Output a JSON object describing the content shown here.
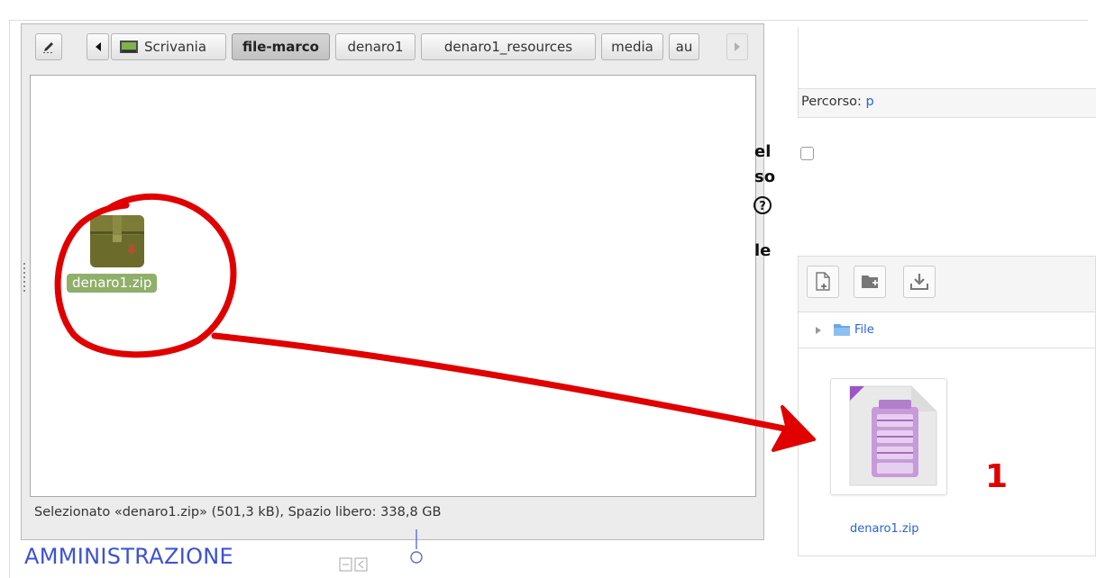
{
  "file_manager": {
    "breadcrumb": [
      "Scrivania",
      "file-marco",
      "denaro1",
      "denaro1_resources",
      "media",
      "au"
    ],
    "active_crumb": "file-marco",
    "file": {
      "name": "denaro1.zip"
    },
    "status": "Selezionato «denaro1.zip» (501,3 kB), Spazio libero: 338,8 GB"
  },
  "admin": {
    "title": "AMMINISTRAZIONE"
  },
  "form": {
    "label_fragments": [
      "el",
      "so",
      "le"
    ],
    "help_glyph": "?",
    "path_label": "Percorso:",
    "path_value": "p"
  },
  "file_picker": {
    "folder": "File",
    "file_name": "denaro1.zip",
    "buttons": [
      "add-file-icon",
      "create-folder-icon",
      "download-icon"
    ]
  },
  "annotation": {
    "number": "1",
    "color": "#e00000"
  },
  "colors": {
    "accent_blue": "#3b51d6",
    "link_blue": "#2b62d9",
    "zip_icon": "#6b6b2c",
    "selection_green": "#8faf6a",
    "annotation_red": "#e00000"
  }
}
